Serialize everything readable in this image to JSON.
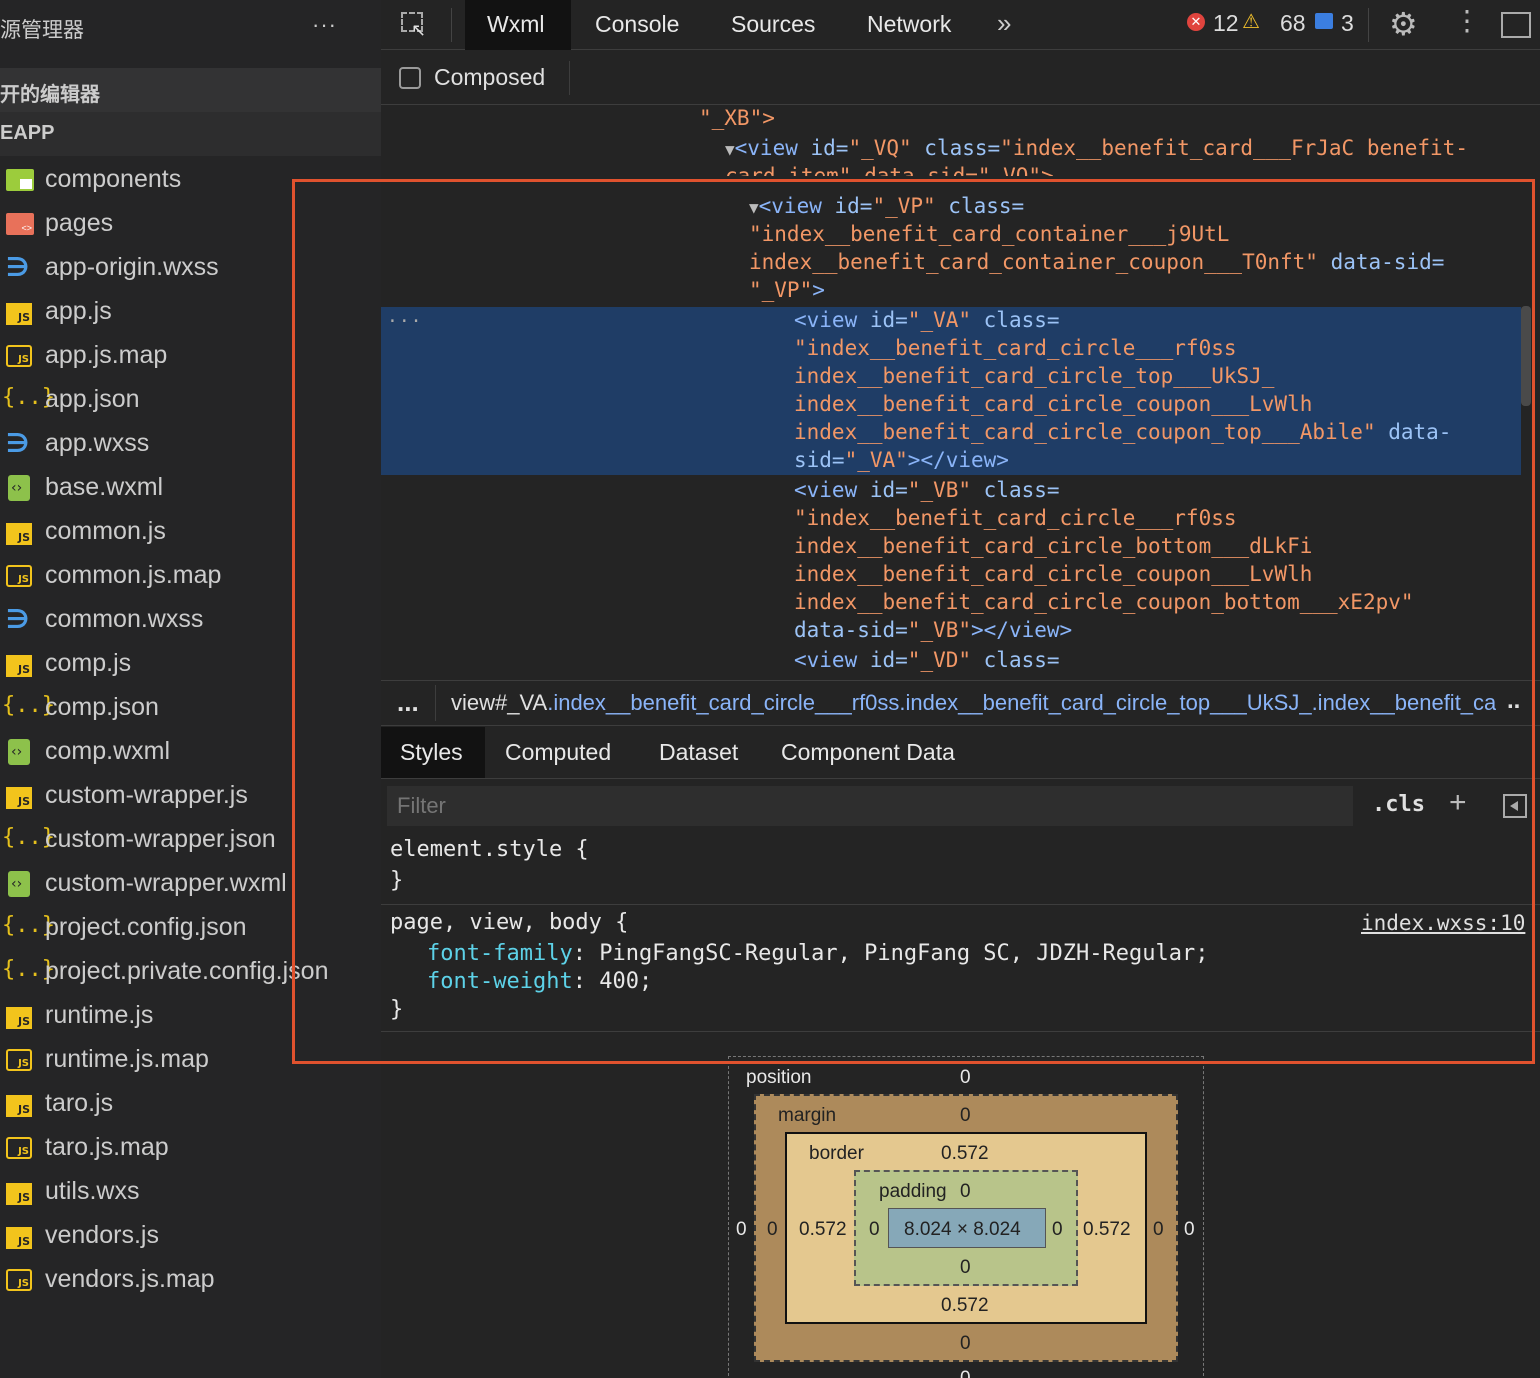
{
  "sidebar": {
    "title": "源管理器",
    "more": "···",
    "open_editors": "开的编辑器",
    "project": "EAPP",
    "files": [
      {
        "name": "components",
        "icon": "folder-components-icon"
      },
      {
        "name": "pages",
        "icon": "folder-pages-icon"
      },
      {
        "name": "app-origin.wxss",
        "icon": "wxss-file-icon"
      },
      {
        "name": "app.js",
        "icon": "js-file-icon"
      },
      {
        "name": "app.js.map",
        "icon": "js-map-file-icon"
      },
      {
        "name": "app.json",
        "icon": "json-file-icon"
      },
      {
        "name": "app.wxss",
        "icon": "wxss-file-icon"
      },
      {
        "name": "base.wxml",
        "icon": "wxml-file-icon"
      },
      {
        "name": "common.js",
        "icon": "js-file-icon"
      },
      {
        "name": "common.js.map",
        "icon": "js-map-file-icon"
      },
      {
        "name": "common.wxss",
        "icon": "wxss-file-icon"
      },
      {
        "name": "comp.js",
        "icon": "js-file-icon"
      },
      {
        "name": "comp.json",
        "icon": "json-file-icon"
      },
      {
        "name": "comp.wxml",
        "icon": "wxml-file-icon"
      },
      {
        "name": "custom-wrapper.js",
        "icon": "js-file-icon"
      },
      {
        "name": "custom-wrapper.json",
        "icon": "json-file-icon"
      },
      {
        "name": "custom-wrapper.wxml",
        "icon": "wxml-file-icon"
      },
      {
        "name": "project.config.json",
        "icon": "json-file-icon"
      },
      {
        "name": "project.private.config.json",
        "icon": "json-file-icon"
      },
      {
        "name": "runtime.js",
        "icon": "js-file-icon"
      },
      {
        "name": "runtime.js.map",
        "icon": "js-map-file-icon"
      },
      {
        "name": "taro.js",
        "icon": "js-file-icon"
      },
      {
        "name": "taro.js.map",
        "icon": "js-map-file-icon"
      },
      {
        "name": "utils.wxs",
        "icon": "js-file-icon"
      },
      {
        "name": "vendors.js",
        "icon": "js-file-icon"
      },
      {
        "name": "vendors.js.map",
        "icon": "js-map-file-icon"
      }
    ]
  },
  "toolbar": {
    "tabs": [
      "Wxml",
      "Console",
      "Sources",
      "Network"
    ],
    "overflow": "»",
    "errors": "12",
    "warnings": "68",
    "infos": "3",
    "error_glyph": "✕",
    "warn_glyph": "⚠",
    "gear_glyph": "⚙",
    "kebab_glyph": "⋮"
  },
  "subbar": {
    "composed_label": "Composed"
  },
  "tree": {
    "line0": "\"_XB\">",
    "vq_open": "<view",
    "vq_attr1": " id=",
    "vq_val1": "\"_VQ\"",
    "vq_attr2": " class=",
    "vq_val2": "\"index__benefit_card___FrJaC benefit-",
    "vq_cont": "card-item\" data-sid=\"_VQ\">",
    "vp_open": "<view",
    "vp_attr1": " id=",
    "vp_val1": "\"_VP\"",
    "vp_attr2": " class=",
    "vp_l2": "\"index__benefit_card_container___j9UtL",
    "vp_l3": "index__benefit_card_container_coupon___T0nft\"",
    "vp_l3b": " data-sid=",
    "vp_l4": "\"_VP\"",
    "vp_l4b": ">",
    "va_open": "<view",
    "va_attr1": " id=",
    "va_val1": "\"_VA\"",
    "va_attr2": " class=",
    "va_l2": "\"index__benefit_card_circle___rf0ss",
    "va_l3": "index__benefit_card_circle_top___UkSJ_",
    "va_l4": "index__benefit_card_circle_coupon___LvWlh",
    "va_l5": "index__benefit_card_circle_coupon_top___Abile\"",
    "va_l5b": " data-",
    "va_l6a": "sid=",
    "va_l6b": "\"_VA\"",
    "va_l6c": "></view>",
    "vb_open": "<view",
    "vb_attr1": " id=",
    "vb_val1": "\"_VB\"",
    "vb_attr2": " class=",
    "vb_l2": "\"index__benefit_card_circle___rf0ss",
    "vb_l3": "index__benefit_card_circle_bottom___dLkFi",
    "vb_l4": "index__benefit_card_circle_coupon___LvWlh",
    "vb_l5": "index__benefit_card_circle_coupon_bottom___xE2pv\"",
    "vb_l6a": "data-sid=",
    "vb_l6b": "\"_VB\"",
    "vb_l6c": "></view>",
    "vd_open": "<view",
    "vd_attr1": " id=",
    "vd_val1": "\"_VD\"",
    "vd_attr2": " class=",
    "sel_dots": "···"
  },
  "breadcrumb": {
    "more": "...",
    "tag": "view#_VA",
    "classes": ".index__benefit_card_circle___rf0ss.index__benefit_card_circle_top___UkSJ_.index__benefit_card_circle_coupon___LvWlh",
    "more_right": ".."
  },
  "styles_panel": {
    "tabs": [
      "Styles",
      "Computed",
      "Dataset",
      "Component Data"
    ],
    "filter_placeholder": "Filter",
    "cls_label": ".cls",
    "plus_label": "+",
    "element_style_open": "element.style {",
    "element_style_close": "}",
    "rule_selector": "page, view, body {",
    "rule_source": "index.wxss:10",
    "prop1_name": "font-family",
    "prop1_value": "PingFangSC-Regular, PingFang SC, JDZH-Regular;",
    "prop2_name": "font-weight",
    "prop2_value": "400;",
    "rule_close": "}"
  },
  "box_model": {
    "position_label": "position",
    "position_top": "0",
    "position_left": "0",
    "position_right": "0",
    "position_bottom": "0",
    "margin_label": "margin",
    "margin_top": "0",
    "margin_left": "0",
    "margin_right": "0",
    "margin_bottom": "0",
    "border_label": "border",
    "border_top": "0.572",
    "border_left": "0.572",
    "border_right": "0.572",
    "border_bottom": "0.572",
    "padding_label": "padding",
    "padding_top": "0",
    "padding_left": "0",
    "padding_right": "0",
    "padding_bottom": "0",
    "content_size": "8.024 × 8.024"
  },
  "colors": {
    "accent_highlight": "#e0522e",
    "selected_row": "#1f3d66",
    "attr_value": "#f29766",
    "tag": "#8ab4f8"
  }
}
